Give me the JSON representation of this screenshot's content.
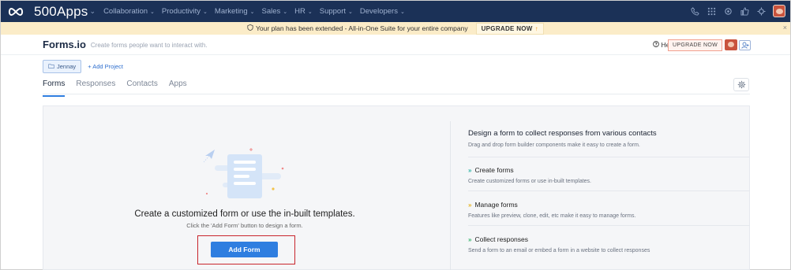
{
  "nav": {
    "brand": "500Apps",
    "menu": [
      "Collaboration",
      "Productivity",
      "Marketing",
      "Sales",
      "HR",
      "Support",
      "Developers"
    ],
    "right_icons": [
      "phone-icon",
      "grid-icon",
      "gear-icon",
      "thumbs-up-icon",
      "settings-icon",
      "avatar"
    ]
  },
  "banner": {
    "message": "Your plan has been extended  - All-in-One Suite for your entire company",
    "upgrade_label": "UPGRADE NOW",
    "close": "×"
  },
  "app": {
    "title": "Forms.io",
    "subtitle": "Create forms people want to interact with.",
    "help_label": "Help",
    "upgrade_label": "UPGRADE NOW"
  },
  "project": {
    "chip_label": "Jennay",
    "add_label": "+ Add Project"
  },
  "tabs": [
    "Forms",
    "Responses",
    "Contacts",
    "Apps"
  ],
  "main": {
    "cta_title": "Create a customized form or use the in-built templates.",
    "cta_sub": "Click the 'Add Form' button to design a form.",
    "add_button": "Add Form"
  },
  "info": {
    "title": "Design a form to collect responses from various contacts",
    "subtitle": "Drag and drop form builder components make it easy to create a form.",
    "features": [
      {
        "title": "Create forms",
        "desc": "Create customized forms or use in-built templates."
      },
      {
        "title": "Manage forms",
        "desc": "Features like preview, clone, edit, etc make it easy to manage forms."
      },
      {
        "title": "Collect responses",
        "desc": "Send a form to an email or embed a form in a website to collect responses"
      }
    ]
  },
  "colors": {
    "nav_bg": "#1b3157",
    "banner_bg": "#fbecc8",
    "accent": "#2f7ee0",
    "highlight_box": "#c8252c"
  }
}
